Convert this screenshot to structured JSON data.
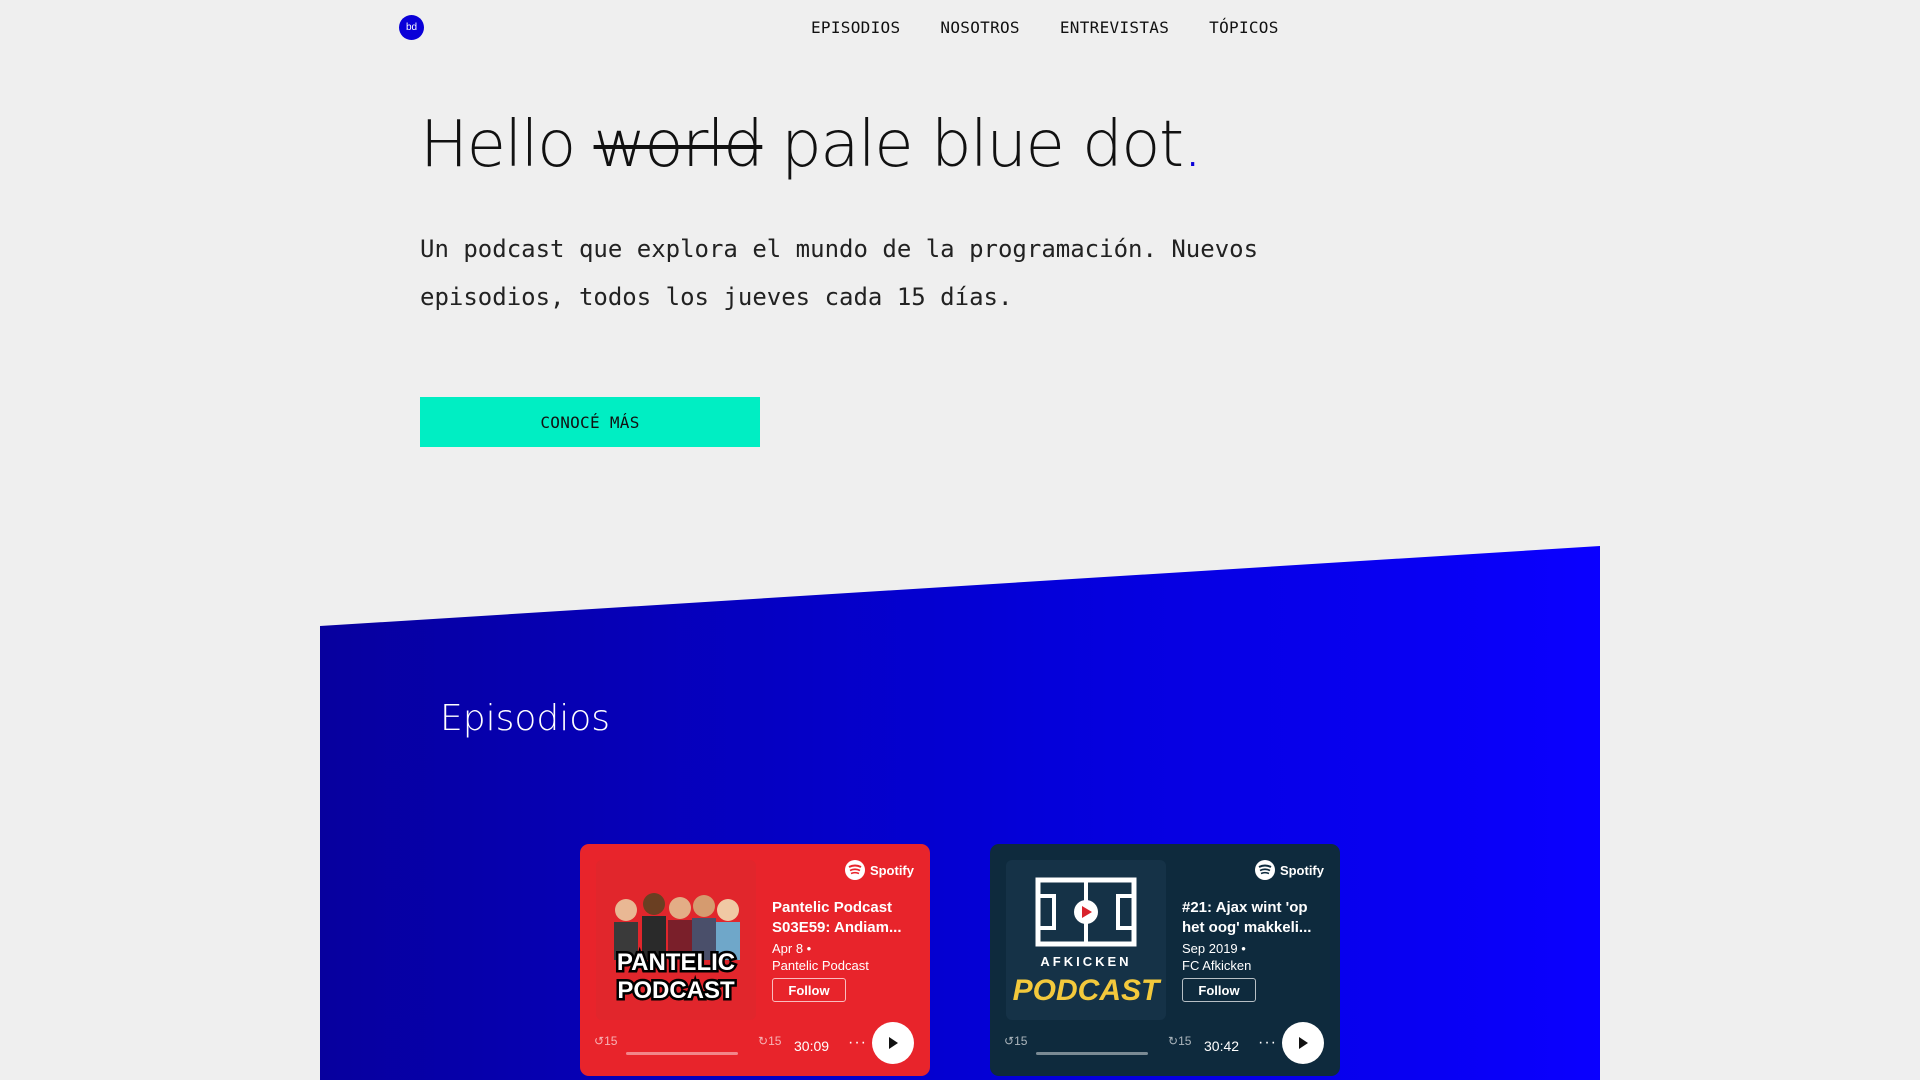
{
  "logo": {
    "text": "bd"
  },
  "nav": {
    "items": [
      "EPISODIOS",
      "NOSOTROS",
      "ENTREVISTAS",
      "TÓPICOS"
    ]
  },
  "hero": {
    "title_prefix": "Hello ",
    "title_strike": "world",
    "title_main": " pale blue dot",
    "title_dot": ".",
    "subtitle": "Un podcast que explora el mundo de la programación. Nuevos episodios, todos los jueves cada 15 días.",
    "cta_label": "CONOCÉ MÁS"
  },
  "episodes_section": {
    "title": "Episodios"
  },
  "colors": {
    "accent_blue": "#0a00d8",
    "cta_green": "#00eec3",
    "card_red": "#e8242b",
    "card_dark": "#0e2a3d"
  },
  "cards": [
    {
      "brand": "Spotify",
      "title_line1": "Pantelic Podcast",
      "title_line2": "S03E59: Andiam...",
      "date": "Apr 8  •",
      "show": "Pantelic Podcast",
      "follow": "Follow",
      "skip_back": "15",
      "skip_fwd": "15",
      "time": "30:09",
      "more": "···",
      "cover_text_1": "PANTELIC",
      "cover_text_2": "PODCAST"
    },
    {
      "brand": "Spotify",
      "title_line1": "#21: Ajax wint 'op",
      "title_line2": "het oog' makkeli...",
      "date": "Sep 2019  •",
      "show": "FC Afkicken",
      "follow": "Follow",
      "skip_back": "15",
      "skip_fwd": "15",
      "time": "30:42",
      "more": "···",
      "cover_text_1": "AFKICKEN",
      "cover_text_2": "PODCAST"
    }
  ]
}
